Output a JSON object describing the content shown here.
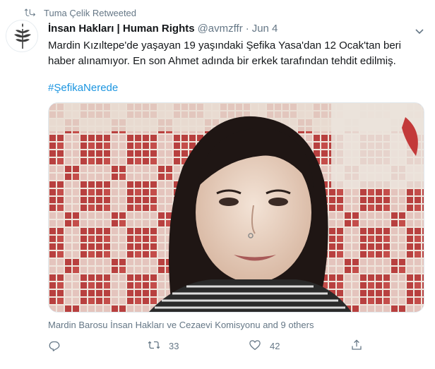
{
  "retweet_context": {
    "label": "Tuma Çelik Retweeted",
    "icon": "retweet-icon"
  },
  "author": {
    "display_name": "İnsan Hakları | Human Rights",
    "handle": "@avmzffr",
    "separator": "·",
    "date": "Jun 4",
    "avatar_icon": "olive-branch-logo"
  },
  "tweet": {
    "line1": "Mardin Kızıltepe'de yaşayan 19 yaşındaki Şefika Yasa'dan 12 Ocak'tan beri",
    "line2": "haber alınamıyor. En son Ahmet adında bir erkek tarafından tehdit edilmiş.",
    "hashtag": "#ŞefikaNerede"
  },
  "media": {
    "type": "photo",
    "subject": "portrait-photo"
  },
  "tagged_context": "Mardin Barosu İnsan Hakları ve Cezaevi Komisyonu and 9 others",
  "actions": {
    "reply_count": "",
    "retweet_count": "33",
    "like_count": "42",
    "share_count": ""
  },
  "colors": {
    "link": "#1b95e0",
    "secondary": "#657786",
    "tile_red": "#b8403f",
    "tile_white": "#efe5dc"
  }
}
